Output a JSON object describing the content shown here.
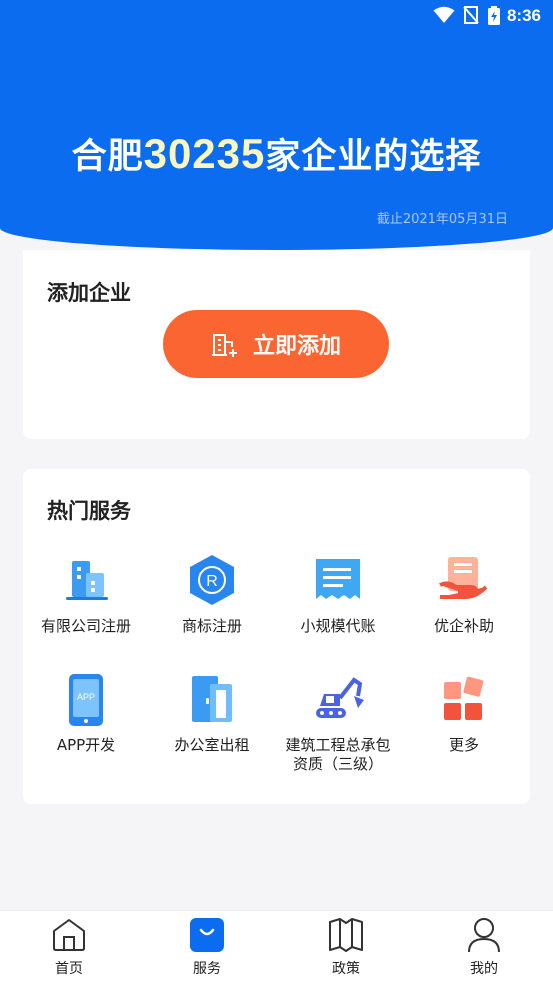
{
  "status_bar": {
    "time": "8:36"
  },
  "hero": {
    "prefix": "合肥",
    "count": "30235",
    "suffix": "家企业的选择",
    "as_of": "截止2021年05月31日"
  },
  "add_company": {
    "title": "添加企业",
    "button_label": "立即添加"
  },
  "hot_services": {
    "title": "热门服务",
    "items": [
      {
        "label": "有限公司注册",
        "icon": "building-icon"
      },
      {
        "label": "商标注册",
        "icon": "trademark-icon"
      },
      {
        "label": "小规模代账",
        "icon": "receipt-icon"
      },
      {
        "label": "优企补助",
        "icon": "subsidy-icon"
      },
      {
        "label": "APP开发",
        "icon": "app-phone-icon"
      },
      {
        "label": "办公室出租",
        "icon": "office-door-icon"
      },
      {
        "label": "建筑工程总承包资质（三级）",
        "label_line1": "建筑工程总承包",
        "label_line2": "资质（三级）",
        "icon": "excavator-icon"
      },
      {
        "label": "更多",
        "icon": "more-grid-icon"
      }
    ]
  },
  "tab_bar": {
    "tabs": [
      {
        "label": "首页",
        "icon": "home-icon"
      },
      {
        "label": "服务",
        "icon": "service-bag-icon",
        "active": true
      },
      {
        "label": "政策",
        "icon": "book-icon"
      },
      {
        "label": "我的",
        "icon": "person-icon"
      }
    ]
  },
  "colors": {
    "brand_blue": "#0b6cf0",
    "accent_orange": "#fb6531",
    "highlight_yellow": "#fdf6c0"
  }
}
